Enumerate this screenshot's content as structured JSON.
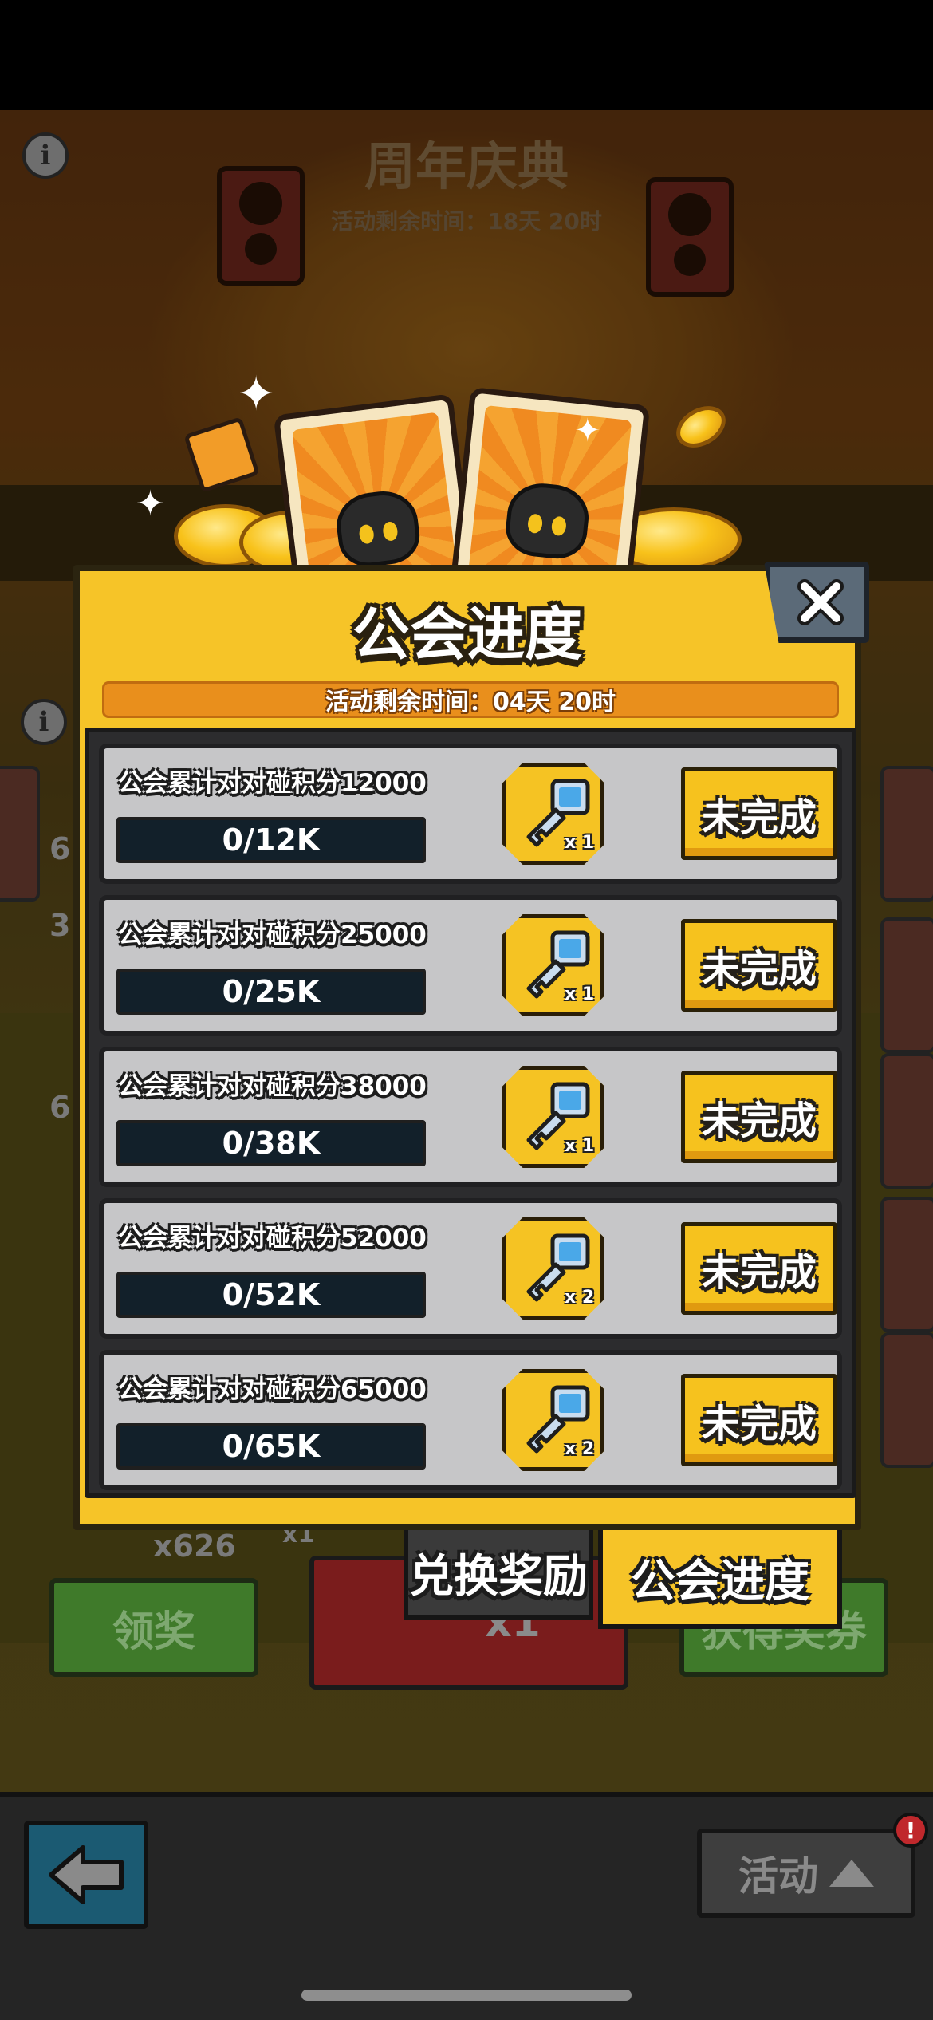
{
  "scene": {
    "title": "周年庆典",
    "timer": "活动剩余时间：18天 20时",
    "claim_button": "领奖",
    "ticket_button": "获得奖券",
    "card_count": "x626",
    "small_count": "x1",
    "draw_count": "x1",
    "info_label": "i",
    "side_numbers": [
      "6",
      "3",
      "6"
    ]
  },
  "modal": {
    "title": "公会进度",
    "timer": "活动剩余时间：04天 20时",
    "tasks": [
      {
        "title": "公会累计对对碰积分12000",
        "progress_text": "0/12K",
        "progress": 0,
        "reward_icon": "key-icon",
        "reward_qty": "x 1",
        "status": "未完成"
      },
      {
        "title": "公会累计对对碰积分25000",
        "progress_text": "0/25K",
        "progress": 0,
        "reward_icon": "key-icon",
        "reward_qty": "x 1",
        "status": "未完成"
      },
      {
        "title": "公会累计对对碰积分38000",
        "progress_text": "0/38K",
        "progress": 0,
        "reward_icon": "key-icon",
        "reward_qty": "x 1",
        "status": "未完成"
      },
      {
        "title": "公会累计对对碰积分52000",
        "progress_text": "0/52K",
        "progress": 0,
        "reward_icon": "key-icon",
        "reward_qty": "x 2",
        "status": "未完成"
      },
      {
        "title": "公会累计对对碰积分65000",
        "progress_text": "0/65K",
        "progress": 0,
        "reward_icon": "key-icon",
        "reward_qty": "x 2",
        "status": "未完成"
      }
    ]
  },
  "tabs": {
    "exchange": "兑换奖励",
    "progress": "公会进度"
  },
  "bottom": {
    "activity": "活动",
    "alert": "!"
  },
  "colors": {
    "accent_yellow": "#f6c428",
    "status_button": "#f6c21e",
    "progress_track": "#12202a",
    "row_background": "#c6c6c8",
    "close_button": "#5b6a78"
  }
}
